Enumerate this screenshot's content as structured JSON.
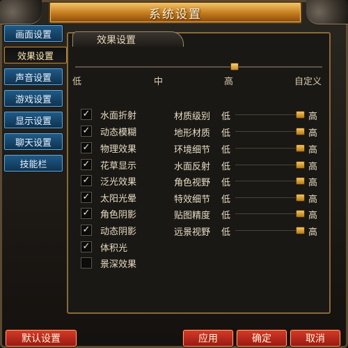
{
  "window": {
    "title": "系统设置"
  },
  "sidebar": {
    "items": [
      {
        "label": "画面设置"
      },
      {
        "label": "效果设置",
        "active": true
      },
      {
        "label": "声音设置"
      },
      {
        "label": "游戏设置"
      },
      {
        "label": "显示设置"
      },
      {
        "label": "聊天设置"
      },
      {
        "label": "技能栏"
      }
    ]
  },
  "panel": {
    "tab_label": "效果设置",
    "preset": {
      "levels": [
        "低",
        "中",
        "高",
        "自定义"
      ],
      "selected": "高"
    },
    "effects": [
      {
        "label": "水面折射",
        "checked": true
      },
      {
        "label": "动态模糊",
        "checked": true
      },
      {
        "label": "物理效果",
        "checked": true
      },
      {
        "label": "花草显示",
        "checked": true
      },
      {
        "label": "泛光效果",
        "checked": true
      },
      {
        "label": "太阳光晕",
        "checked": true
      },
      {
        "label": "角色阴影",
        "checked": true
      },
      {
        "label": "动态阴影",
        "checked": true
      },
      {
        "label": "体积光",
        "checked": true
      },
      {
        "label": "景深效果",
        "checked": false
      }
    ],
    "quality": {
      "low_label": "低",
      "high_label": "高",
      "items": [
        {
          "label": "材质级别",
          "value": "高"
        },
        {
          "label": "地形材质",
          "value": "高"
        },
        {
          "label": "环境细节",
          "value": "高"
        },
        {
          "label": "水面反射",
          "value": "高"
        },
        {
          "label": "角色视野",
          "value": "高"
        },
        {
          "label": "特效细节",
          "value": "高"
        },
        {
          "label": "贴图精度",
          "value": "高"
        },
        {
          "label": "远景视野",
          "value": "高"
        }
      ]
    }
  },
  "buttons": {
    "defaults": "默认设置",
    "apply": "应用",
    "ok": "确定",
    "cancel": "取消"
  },
  "colors": {
    "accent_gold": "#d9a441",
    "tab_blue": "#1f5a86",
    "button_red": "#c02a1c"
  }
}
